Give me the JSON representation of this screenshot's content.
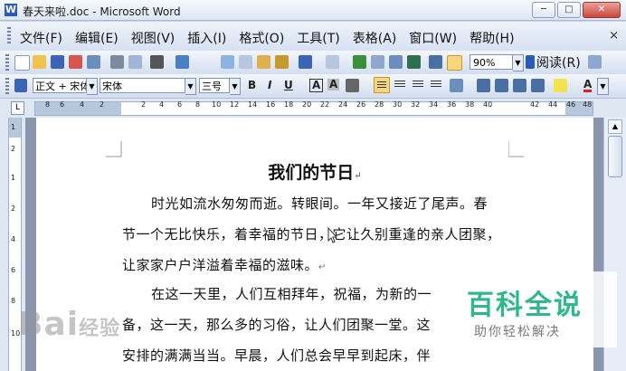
{
  "window": {
    "title": "春天来啦.doc - Microsoft Word",
    "app_icon_letter": "W"
  },
  "menubar": {
    "items": [
      "文件(F)",
      "编辑(E)",
      "视图(V)",
      "插入(I)",
      "格式(O)",
      "工具(T)",
      "表格(A)",
      "窗口(W)",
      "帮助(H)"
    ],
    "close_glyph": "×"
  },
  "standard_toolbar": {
    "zoom_value": "90%",
    "read_label": "阅读(R)"
  },
  "formatting_toolbar": {
    "style_value": "正文 + 宋体",
    "font_value": "宋体",
    "size_value": "三号",
    "bold_label": "B",
    "italic_label": "I",
    "underline_label": "U",
    "char_border_label": "A",
    "char_shading_label": "A",
    "font_color_label": "A"
  },
  "ruler": {
    "tab_selector": "L",
    "labels": [
      "8",
      "6",
      "4",
      "2",
      "2",
      "4",
      "6",
      "8",
      "10",
      "12",
      "14",
      "16",
      "18",
      "20",
      "22",
      "24",
      "26",
      "28",
      "30",
      "32",
      "34",
      "36",
      "38",
      "40",
      "42",
      "44",
      "46",
      "48"
    ],
    "vertical_labels": [
      "1",
      "2",
      "1",
      "2",
      "4",
      "6",
      "8",
      "10"
    ]
  },
  "document": {
    "title": "我们的节日",
    "lines": [
      "时光如流水匆匆而逝。转眼间。一年又接近了尾声。春",
      "节一个无比快乐，着幸福的节日，它让久别重逢的亲人团聚，",
      "让家家户户洋溢着幸福的滋味。",
      "在这一天里，人们互相拜年，祝福，为新的一",
      "备，这一天，那么多的习俗，让人们团聚一堂。这",
      "安排的满满当当。早晨，人们总会早早到起床，伴"
    ],
    "paragraph_mark": "↵"
  },
  "watermarks": {
    "left_text": "Bai",
    "left_tail": "经验",
    "right_main": "百科全说",
    "right_sub": "助你轻松解决"
  },
  "colors": {
    "accent_green": "#2fb98b",
    "highlight_yellow": "#f9d57b",
    "font_color_red": "#e02020"
  }
}
